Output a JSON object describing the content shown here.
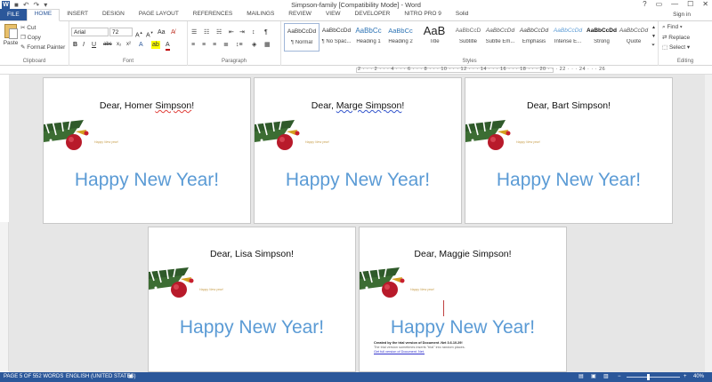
{
  "window": {
    "title": "Simpson-family [Compatibility Mode] - Word",
    "signin": "Sign in",
    "controls": [
      "?",
      "▭",
      "—",
      "☐",
      "✕"
    ]
  },
  "qat": [
    "↶",
    "↷",
    "▾"
  ],
  "tabs": [
    "FILE",
    "HOME",
    "INSERT",
    "DESIGN",
    "PAGE LAYOUT",
    "REFERENCES",
    "MAILINGS",
    "REVIEW",
    "VIEW",
    "DEVELOPER",
    "NITRO PRO 9",
    "Solid"
  ],
  "active_tab": "HOME",
  "clipboard": {
    "paste": "Paste",
    "cut": "Cut",
    "copy": "Copy",
    "format_painter": "Format Painter",
    "label": "Clipboard"
  },
  "font": {
    "name": "Arial",
    "size": "72",
    "label": "Font",
    "buttons": [
      "B",
      "I",
      "U",
      "abc",
      "x₂",
      "x²"
    ]
  },
  "paragraph": {
    "label": "Paragraph"
  },
  "styles": {
    "label": "Styles",
    "items": [
      {
        "sample": "AaBbCcDd",
        "name": "¶ Normal",
        "color": "#333333"
      },
      {
        "sample": "AaBbCcDd",
        "name": "¶ No Spac...",
        "color": "#333333"
      },
      {
        "sample": "AaBbCc",
        "name": "Heading 1",
        "color": "#2e74b5"
      },
      {
        "sample": "AaBbCc",
        "name": "Heading 2",
        "color": "#2e74b5"
      },
      {
        "sample": "AaB",
        "name": "Title",
        "color": "#222222"
      },
      {
        "sample": "AaBbCcD",
        "name": "Subtitle",
        "color": "#666666"
      },
      {
        "sample": "AaBbCcDd",
        "name": "Subtle Em...",
        "color": "#555555"
      },
      {
        "sample": "AaBbCcDd",
        "name": "Emphasis",
        "color": "#444444"
      },
      {
        "sample": "AaBbCcDd",
        "name": "Intense E...",
        "color": "#5b9bd5"
      },
      {
        "sample": "AaBbCcDd",
        "name": "Strong",
        "color": "#111111"
      },
      {
        "sample": "AaBbCcDd",
        "name": "Quote",
        "color": "#555555"
      }
    ]
  },
  "editing": {
    "find": "Find",
    "replace": "Replace",
    "select": "Select",
    "label": "Editing"
  },
  "ruler": "2 · · · 2 · · · 4 · · · 6 · · · 8 · · · 10 · · · 12 · · · 14 · · · 16 · · · 18 · · · 20 · · · 22 · · · 24 · · · 26",
  "pages": [
    {
      "greeting_prefix": "Dear, Homer ",
      "greeting_name": "Simpson",
      "greeting_suffix": "!",
      "wish": "Happy New Year!",
      "small_wish": "Happy New year!"
    },
    {
      "greeting_prefix": "Dear, ",
      "greeting_name": "Marge  Simpson",
      "greeting_suffix": "!",
      "wish": "Happy New Year!",
      "small_wish": "Happy New year!"
    },
    {
      "greeting_prefix": "Dear, Bart Simpson!",
      "greeting_name": "",
      "greeting_suffix": "",
      "wish": "Happy New Year!",
      "small_wish": "Happy New year!"
    },
    {
      "greeting_prefix": "Dear, Lisa Simpson!",
      "greeting_name": "",
      "greeting_suffix": "",
      "wish": "Happy New Year!",
      "small_wish": "Happy New year!"
    },
    {
      "greeting_prefix": "Dear, Maggie Simpson!",
      "greeting_name": "",
      "greeting_suffix": "",
      "wish": "Happy New Year!",
      "small_wish": "Happy New year!"
    }
  ],
  "trial_note": {
    "line1": "Created by the trial version of Document .Net 3.6.10.29!",
    "line2": "The trial version sometimes inserts \"trial\" into random places.",
    "line3": "Get full version of Document .Net."
  },
  "status": {
    "page": "PAGE 5 OF 5",
    "words": "52 WORDS",
    "language": "ENGLISH (UNITED STATES)",
    "zoom": "40%"
  },
  "colors": {
    "accent": "#2b579a",
    "wish": "#5b9bd5"
  }
}
